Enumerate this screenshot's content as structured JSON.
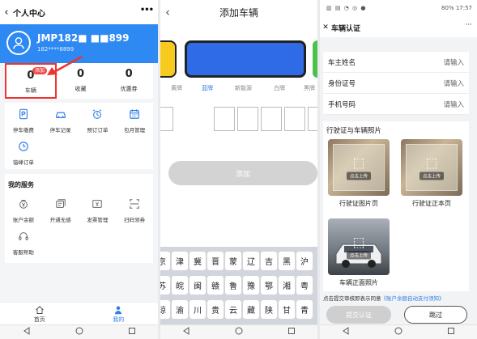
{
  "colors": {
    "accent": "#2f89f3",
    "highlight": "#e33333",
    "disabled": "#d3d3d3"
  },
  "p1": {
    "title": "个人中心",
    "user_name": "JMP182■ ■■899",
    "user_phone": "182****8899",
    "stats": [
      {
        "num": "0",
        "label": "车辆",
        "badge": "添加"
      },
      {
        "num": "0",
        "label": "收藏"
      },
      {
        "num": "0",
        "label": "优惠券"
      }
    ],
    "grid1": [
      {
        "label": "停车缴费",
        "icon": "parking-pay-icon"
      },
      {
        "label": "停车记录",
        "icon": "car-icon"
      },
      {
        "label": "预订订单",
        "icon": "alarm-icon"
      },
      {
        "label": "包月管理",
        "icon": "calendar-icon"
      },
      {
        "label": "错峰订单",
        "icon": "clock-icon"
      }
    ],
    "services_title": "我的服务",
    "grid2": [
      {
        "label": "账户余额",
        "icon": "wallet-icon"
      },
      {
        "label": "开通无感",
        "icon": "card-icon"
      },
      {
        "label": "发票管理",
        "icon": "invoice-icon"
      },
      {
        "label": "扫码领券",
        "icon": "scan-icon"
      },
      {
        "label": "客服帮助",
        "icon": "headset-icon"
      }
    ],
    "tabs": [
      {
        "label": "首页"
      },
      {
        "label": "我的"
      }
    ]
  },
  "p2": {
    "title": "添加车辆",
    "plate_tabs": [
      "黄牌",
      "蓝牌",
      "新能源",
      "白牌",
      "黑牌"
    ],
    "add_label": "添加",
    "keyboard": [
      [
        "京",
        "津",
        "冀",
        "晋",
        "蒙",
        "辽",
        "吉",
        "黑",
        "沪"
      ],
      [
        "苏",
        "皖",
        "闽",
        "赣",
        "鲁",
        "豫",
        "鄂",
        "湘",
        "粤"
      ],
      [
        "琼",
        "渝",
        "川",
        "贵",
        "云",
        "藏",
        "陕",
        "甘",
        "青"
      ]
    ]
  },
  "p3": {
    "status_right": "80% 17:57",
    "title": "车辆认证",
    "fields": [
      {
        "label": "车主姓名",
        "placeholder": "请输入"
      },
      {
        "label": "身份证号",
        "placeholder": "请输入"
      },
      {
        "label": "手机号码",
        "placeholder": "请输入"
      }
    ],
    "photos_title": "行驶证与车辆照片",
    "photos": [
      {
        "caption": "行驶证图片页",
        "upload": "点击上传"
      },
      {
        "caption": "行驶证正本页",
        "upload": "点击上传"
      },
      {
        "caption": "车辆正面照片",
        "upload": "点击上传"
      }
    ],
    "agree_text": "点击提交审核即表示同意",
    "agree_link": "《账户余额自动支付须知》",
    "submit_label": "提交认证",
    "skip_label": "跳过"
  }
}
